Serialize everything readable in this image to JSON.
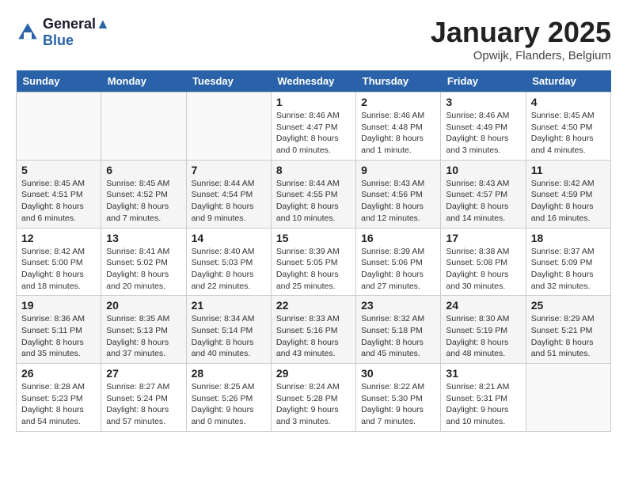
{
  "header": {
    "logo_line1": "General",
    "logo_line2": "Blue",
    "title": "January 2025",
    "subtitle": "Opwijk, Flanders, Belgium"
  },
  "days_of_week": [
    "Sunday",
    "Monday",
    "Tuesday",
    "Wednesday",
    "Thursday",
    "Friday",
    "Saturday"
  ],
  "weeks": [
    [
      {
        "num": "",
        "info": ""
      },
      {
        "num": "",
        "info": ""
      },
      {
        "num": "",
        "info": ""
      },
      {
        "num": "1",
        "info": "Sunrise: 8:46 AM\nSunset: 4:47 PM\nDaylight: 8 hours\nand 0 minutes."
      },
      {
        "num": "2",
        "info": "Sunrise: 8:46 AM\nSunset: 4:48 PM\nDaylight: 8 hours\nand 1 minute."
      },
      {
        "num": "3",
        "info": "Sunrise: 8:46 AM\nSunset: 4:49 PM\nDaylight: 8 hours\nand 3 minutes."
      },
      {
        "num": "4",
        "info": "Sunrise: 8:45 AM\nSunset: 4:50 PM\nDaylight: 8 hours\nand 4 minutes."
      }
    ],
    [
      {
        "num": "5",
        "info": "Sunrise: 8:45 AM\nSunset: 4:51 PM\nDaylight: 8 hours\nand 6 minutes."
      },
      {
        "num": "6",
        "info": "Sunrise: 8:45 AM\nSunset: 4:52 PM\nDaylight: 8 hours\nand 7 minutes."
      },
      {
        "num": "7",
        "info": "Sunrise: 8:44 AM\nSunset: 4:54 PM\nDaylight: 8 hours\nand 9 minutes."
      },
      {
        "num": "8",
        "info": "Sunrise: 8:44 AM\nSunset: 4:55 PM\nDaylight: 8 hours\nand 10 minutes."
      },
      {
        "num": "9",
        "info": "Sunrise: 8:43 AM\nSunset: 4:56 PM\nDaylight: 8 hours\nand 12 minutes."
      },
      {
        "num": "10",
        "info": "Sunrise: 8:43 AM\nSunset: 4:57 PM\nDaylight: 8 hours\nand 14 minutes."
      },
      {
        "num": "11",
        "info": "Sunrise: 8:42 AM\nSunset: 4:59 PM\nDaylight: 8 hours\nand 16 minutes."
      }
    ],
    [
      {
        "num": "12",
        "info": "Sunrise: 8:42 AM\nSunset: 5:00 PM\nDaylight: 8 hours\nand 18 minutes."
      },
      {
        "num": "13",
        "info": "Sunrise: 8:41 AM\nSunset: 5:02 PM\nDaylight: 8 hours\nand 20 minutes."
      },
      {
        "num": "14",
        "info": "Sunrise: 8:40 AM\nSunset: 5:03 PM\nDaylight: 8 hours\nand 22 minutes."
      },
      {
        "num": "15",
        "info": "Sunrise: 8:39 AM\nSunset: 5:05 PM\nDaylight: 8 hours\nand 25 minutes."
      },
      {
        "num": "16",
        "info": "Sunrise: 8:39 AM\nSunset: 5:06 PM\nDaylight: 8 hours\nand 27 minutes."
      },
      {
        "num": "17",
        "info": "Sunrise: 8:38 AM\nSunset: 5:08 PM\nDaylight: 8 hours\nand 30 minutes."
      },
      {
        "num": "18",
        "info": "Sunrise: 8:37 AM\nSunset: 5:09 PM\nDaylight: 8 hours\nand 32 minutes."
      }
    ],
    [
      {
        "num": "19",
        "info": "Sunrise: 8:36 AM\nSunset: 5:11 PM\nDaylight: 8 hours\nand 35 minutes."
      },
      {
        "num": "20",
        "info": "Sunrise: 8:35 AM\nSunset: 5:13 PM\nDaylight: 8 hours\nand 37 minutes."
      },
      {
        "num": "21",
        "info": "Sunrise: 8:34 AM\nSunset: 5:14 PM\nDaylight: 8 hours\nand 40 minutes."
      },
      {
        "num": "22",
        "info": "Sunrise: 8:33 AM\nSunset: 5:16 PM\nDaylight: 8 hours\nand 43 minutes."
      },
      {
        "num": "23",
        "info": "Sunrise: 8:32 AM\nSunset: 5:18 PM\nDaylight: 8 hours\nand 45 minutes."
      },
      {
        "num": "24",
        "info": "Sunrise: 8:30 AM\nSunset: 5:19 PM\nDaylight: 8 hours\nand 48 minutes."
      },
      {
        "num": "25",
        "info": "Sunrise: 8:29 AM\nSunset: 5:21 PM\nDaylight: 8 hours\nand 51 minutes."
      }
    ],
    [
      {
        "num": "26",
        "info": "Sunrise: 8:28 AM\nSunset: 5:23 PM\nDaylight: 8 hours\nand 54 minutes."
      },
      {
        "num": "27",
        "info": "Sunrise: 8:27 AM\nSunset: 5:24 PM\nDaylight: 8 hours\nand 57 minutes."
      },
      {
        "num": "28",
        "info": "Sunrise: 8:25 AM\nSunset: 5:26 PM\nDaylight: 9 hours\nand 0 minutes."
      },
      {
        "num": "29",
        "info": "Sunrise: 8:24 AM\nSunset: 5:28 PM\nDaylight: 9 hours\nand 3 minutes."
      },
      {
        "num": "30",
        "info": "Sunrise: 8:22 AM\nSunset: 5:30 PM\nDaylight: 9 hours\nand 7 minutes."
      },
      {
        "num": "31",
        "info": "Sunrise: 8:21 AM\nSunset: 5:31 PM\nDaylight: 9 hours\nand 10 minutes."
      },
      {
        "num": "",
        "info": ""
      }
    ]
  ]
}
